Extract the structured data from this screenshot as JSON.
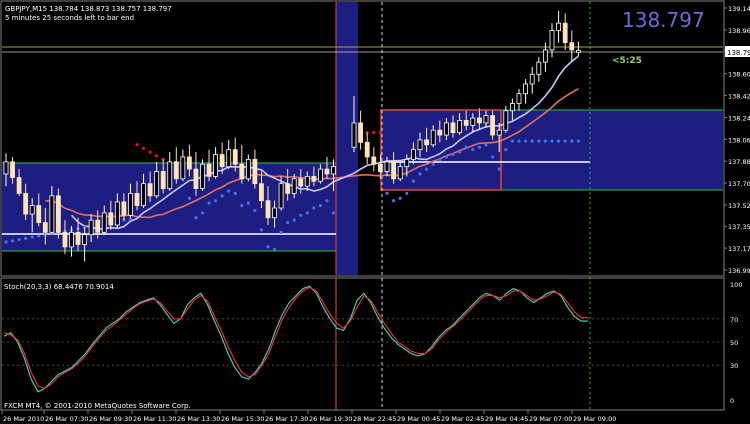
{
  "header": {
    "symbol_line": "GBPJPY,M15  138.784 138.873 138.757 138.797",
    "timer_line": "5 minutes 25 seconds left to bar end",
    "big_price": "138.797",
    "countdown": "<5:25"
  },
  "footer": {
    "copyright": "FXCM MT4, © 2001-2010 MetaQuotes Software Corp."
  },
  "colors": {
    "background": "#000000",
    "grid": "#3a3a3a",
    "bull_candle": "#ffffff",
    "bear_candle": "#ffe4b5",
    "range_box": "#1e1e82",
    "box_border": "#e04a2a",
    "box_edges": "#2fbf3a",
    "ma_slow": "#e07060",
    "ma_fast": "#c8c8ff",
    "trail_dots_up": "#4a6ee8",
    "trail_dots_down": "#e01818",
    "stoch_main": "#30e0d0",
    "stoch_signal": "#ff3030",
    "big_price": "#6c6cd8",
    "countdown": "#9cd06c"
  },
  "chart_data": [
    {
      "type": "candlestick",
      "title": "GBPJPY,M15",
      "price_axis": [
        "139.145",
        "138.965",
        "138.797",
        "138.605",
        "138.425",
        "138.245",
        "138.065",
        "137.885",
        "137.705",
        "137.525",
        "137.350",
        "137.170",
        "136.990"
      ],
      "ylim": [
        136.99,
        139.145
      ],
      "time_labels": [
        "26 Mar 2010",
        "26 Mar 07:30",
        "26 Mar 09:30",
        "26 Mar 11:30",
        "26 Mar 13:30",
        "26 Mar 15:30",
        "26 Mar 17:30",
        "26 Mar 19:30",
        "28 Mar 22:45",
        "29 Mar 00:45",
        "29 Mar 02:45",
        "29 Mar 04:45",
        "29 Mar 07:00",
        "29 Mar 09:00"
      ],
      "current_price": 138.797,
      "candles": [
        [
          137.78,
          137.95,
          137.68,
          137.88
        ],
        [
          137.88,
          137.92,
          137.7,
          137.75
        ],
        [
          137.75,
          137.82,
          137.6,
          137.62
        ],
        [
          137.62,
          137.7,
          137.4,
          137.45
        ],
        [
          137.45,
          137.58,
          137.3,
          137.52
        ],
        [
          137.52,
          137.62,
          137.35,
          137.38
        ],
        [
          137.38,
          137.5,
          137.2,
          137.3
        ],
        [
          137.3,
          137.68,
          137.28,
          137.6
        ],
        [
          137.6,
          137.66,
          137.25,
          137.3
        ],
        [
          137.3,
          137.4,
          137.12,
          137.18
        ],
        [
          137.18,
          137.35,
          137.1,
          137.3
        ],
        [
          137.3,
          137.42,
          137.15,
          137.2
        ],
        [
          137.2,
          137.34,
          137.06,
          137.28
        ],
        [
          137.28,
          137.45,
          137.22,
          137.4
        ],
        [
          137.4,
          137.48,
          137.25,
          137.3
        ],
        [
          137.3,
          137.52,
          137.28,
          137.46
        ],
        [
          137.46,
          137.56,
          137.32,
          137.36
        ],
        [
          137.36,
          137.62,
          137.34,
          137.55
        ],
        [
          137.55,
          137.62,
          137.4,
          137.44
        ],
        [
          137.44,
          137.7,
          137.42,
          137.62
        ],
        [
          137.62,
          137.72,
          137.48,
          137.52
        ],
        [
          137.52,
          137.78,
          137.5,
          137.7
        ],
        [
          137.7,
          137.8,
          137.55,
          137.6
        ],
        [
          137.6,
          137.88,
          137.58,
          137.8
        ],
        [
          137.8,
          137.9,
          137.62,
          137.66
        ],
        [
          137.66,
          137.96,
          137.64,
          137.88
        ],
        [
          137.88,
          138.0,
          137.7,
          137.74
        ],
        [
          137.74,
          137.98,
          137.72,
          137.92
        ],
        [
          137.92,
          138.02,
          137.76,
          137.82
        ],
        [
          137.82,
          137.96,
          137.6,
          137.66
        ],
        [
          137.66,
          137.9,
          137.64,
          137.86
        ],
        [
          137.86,
          137.98,
          137.72,
          137.76
        ],
        [
          137.76,
          138.0,
          137.74,
          137.94
        ],
        [
          137.94,
          138.04,
          137.78,
          137.84
        ],
        [
          137.84,
          138.06,
          137.82,
          137.98
        ],
        [
          137.98,
          138.08,
          137.8,
          137.86
        ],
        [
          137.86,
          138.02,
          137.7,
          137.74
        ],
        [
          137.74,
          137.94,
          137.72,
          137.9
        ],
        [
          137.9,
          137.98,
          137.66,
          137.7
        ],
        [
          137.7,
          137.8,
          137.5,
          137.56
        ],
        [
          137.56,
          137.68,
          137.36,
          137.42
        ],
        [
          137.42,
          137.56,
          137.34,
          137.5
        ],
        [
          137.5,
          137.76,
          137.48,
          137.7
        ],
        [
          137.7,
          137.82,
          137.56,
          137.62
        ],
        [
          137.62,
          137.78,
          137.58,
          137.74
        ],
        [
          137.74,
          137.82,
          137.62,
          137.68
        ],
        [
          137.68,
          137.8,
          137.64,
          137.76
        ],
        [
          137.76,
          137.84,
          137.68,
          137.72
        ],
        [
          137.72,
          137.86,
          137.7,
          137.82
        ],
        [
          137.82,
          137.92,
          137.74,
          137.78
        ],
        [
          137.78,
          137.9,
          137.64,
          137.84
        ],
        [
          138.0,
          138.42,
          137.96,
          138.2
        ],
        [
          138.2,
          138.3,
          137.98,
          138.04
        ],
        [
          138.04,
          138.12,
          137.86,
          137.92
        ],
        [
          137.92,
          138.0,
          137.8,
          137.86
        ],
        [
          137.86,
          137.94,
          137.74,
          137.8
        ],
        [
          137.8,
          137.92,
          137.76,
          137.88
        ],
        [
          137.88,
          137.96,
          137.7,
          137.74
        ],
        [
          137.74,
          137.88,
          137.72,
          137.84
        ],
        [
          137.84,
          137.94,
          137.76,
          137.9
        ],
        [
          137.9,
          138.04,
          137.86,
          137.98
        ],
        [
          137.98,
          138.12,
          137.92,
          138.06
        ],
        [
          138.06,
          138.16,
          137.96,
          138.02
        ],
        [
          138.02,
          138.18,
          138.0,
          138.14
        ],
        [
          138.14,
          138.22,
          138.04,
          138.1
        ],
        [
          138.1,
          138.24,
          138.06,
          138.2
        ],
        [
          138.2,
          138.26,
          138.08,
          138.12
        ],
        [
          138.12,
          138.28,
          138.1,
          138.22
        ],
        [
          138.22,
          138.3,
          138.14,
          138.18
        ],
        [
          138.18,
          138.28,
          138.12,
          138.24
        ],
        [
          138.24,
          138.32,
          138.14,
          138.2
        ],
        [
          138.2,
          138.3,
          138.16,
          138.26
        ],
        [
          138.26,
          138.3,
          138.06,
          138.1
        ],
        [
          138.1,
          138.2,
          137.96,
          138.14
        ],
        [
          138.14,
          138.34,
          138.12,
          138.3
        ],
        [
          138.3,
          138.4,
          138.22,
          138.36
        ],
        [
          138.36,
          138.48,
          138.3,
          138.44
        ],
        [
          138.44,
          138.56,
          138.36,
          138.52
        ],
        [
          138.52,
          138.66,
          138.44,
          138.6
        ],
        [
          138.6,
          138.74,
          138.54,
          138.7
        ],
        [
          138.7,
          138.86,
          138.62,
          138.8
        ],
        [
          138.8,
          139.02,
          138.74,
          138.96
        ],
        [
          138.96,
          139.12,
          138.86,
          139.02
        ],
        [
          139.02,
          139.1,
          138.8,
          138.86
        ],
        [
          138.86,
          138.96,
          138.7,
          138.8
        ],
        [
          138.78,
          138.87,
          138.75,
          138.797
        ]
      ]
    },
    {
      "type": "line",
      "title": "Stoch(20,3,3) 68.4476 70.9014",
      "yticks": [
        "100",
        "70",
        "50",
        "30",
        "0"
      ],
      "ylim": [
        0,
        100
      ],
      "series": [
        {
          "name": "main",
          "values": [
            55,
            58,
            50,
            36,
            18,
            7,
            10,
            16,
            22,
            25,
            28,
            34,
            40,
            48,
            55,
            62,
            66,
            70,
            76,
            80,
            84,
            86,
            88,
            82,
            74,
            66,
            70,
            82,
            88,
            92,
            82,
            68,
            55,
            40,
            28,
            20,
            18,
            24,
            32,
            44,
            60,
            74,
            84,
            90,
            96,
            98,
            92,
            80,
            70,
            62,
            60,
            70,
            86,
            92,
            84,
            72,
            62,
            54,
            48,
            44,
            40,
            38,
            40,
            46,
            54,
            60,
            64,
            70,
            76,
            82,
            88,
            92,
            90,
            86,
            92,
            96,
            94,
            88,
            84,
            88,
            92,
            94,
            90,
            80,
            72,
            68,
            68
          ]
        },
        {
          "name": "signal",
          "values": [
            58,
            56,
            52,
            40,
            24,
            12,
            10,
            14,
            20,
            24,
            27,
            32,
            38,
            46,
            53,
            60,
            64,
            69,
            74,
            79,
            83,
            85,
            87,
            84,
            77,
            70,
            70,
            78,
            86,
            90,
            85,
            72,
            60,
            46,
            34,
            24,
            20,
            22,
            30,
            40,
            55,
            70,
            80,
            88,
            94,
            97,
            94,
            84,
            74,
            66,
            62,
            68,
            80,
            90,
            86,
            76,
            66,
            58,
            50,
            46,
            42,
            40,
            40,
            44,
            52,
            58,
            63,
            68,
            74,
            80,
            86,
            90,
            90,
            88,
            90,
            94,
            94,
            90,
            86,
            87,
            90,
            93,
            91,
            84,
            76,
            71,
            71
          ]
        }
      ]
    }
  ]
}
